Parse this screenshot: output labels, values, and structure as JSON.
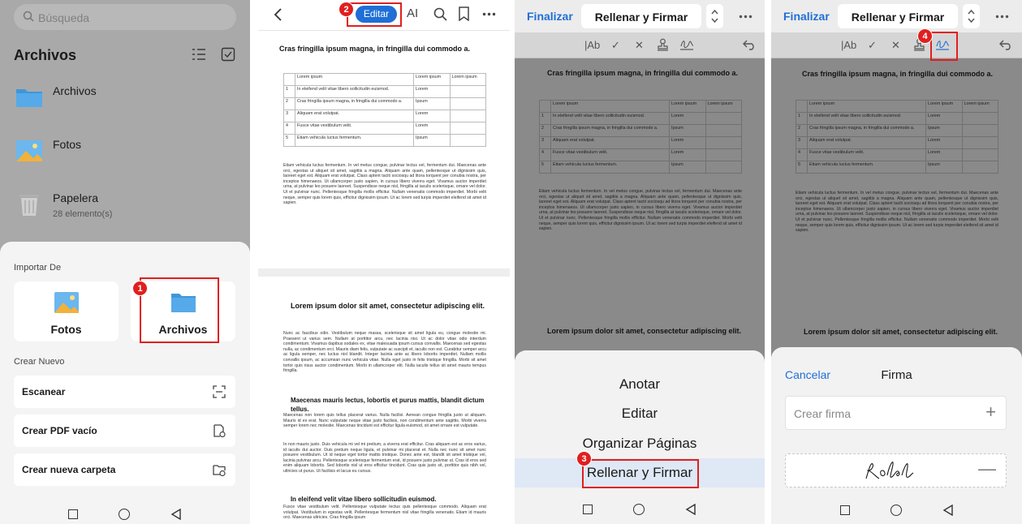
{
  "panel1": {
    "search_placeholder": "Búsqueda",
    "title": "Archivos",
    "files": [
      {
        "name": "Archivos",
        "meta": "",
        "icon": "folder-icon"
      },
      {
        "name": "Fotos",
        "meta": "",
        "icon": "photo-icon"
      },
      {
        "name": "Papelera",
        "meta": "28 elemento(s)",
        "icon": "trash-icon"
      }
    ],
    "import_label": "Importar De",
    "import_options": [
      {
        "label": "Fotos",
        "icon": "photo-icon"
      },
      {
        "label": "Archivos",
        "icon": "folder-icon"
      }
    ],
    "create_label": "Crear Nuevo",
    "create_options": [
      {
        "label": "Escanear",
        "icon": "scan-icon"
      },
      {
        "label": "Crear PDF vacío",
        "icon": "new-pdf-icon"
      },
      {
        "label": "Crear nueva carpeta",
        "icon": "new-folder-icon"
      }
    ],
    "badge": "1"
  },
  "panel2": {
    "edit_label": "Editar",
    "ai_label": "AI",
    "badge": "2",
    "doc": {
      "heading1": "Cras fringilla ipsum magna, in fringilla dui commodo a.",
      "table": {
        "header": [
          "",
          "Lorem ipsum",
          "Lorem ipsum",
          "Lorem ipsum"
        ],
        "rows": [
          [
            "1",
            "In eleifend velit vitae libero sollicitudin euismod.",
            "Lorem",
            ""
          ],
          [
            "2",
            "Cras fringilla ipsum magna, in fringilla dui commodo a.",
            "Ipsum",
            ""
          ],
          [
            "3",
            "Aliquam erat volutpat.",
            "Lorem",
            ""
          ],
          [
            "4",
            "Fusce vitae vestibulum velit.",
            "Lorem",
            ""
          ],
          [
            "5",
            "Etiam vehicula luctus fermentum.",
            "Ipsum",
            ""
          ]
        ]
      },
      "para1": "Etiam vehicula luctus fermentum. In vel metus congue, pulvinar lectus vel, fermentum dui. Maecenas ante orci, egestas ut aliquet sit amet, sagittis a magna. Aliquam ante quam, pellentesque ut dignissim quis, laoreet eget est. Aliquam erat volutpat. Class aptent taciti sociosqu ad litora torquent per conubia nostra, per inceptos himenaeos. Ut ullamcorper justo sapien, in cursus libero viverra eget. Vivamus auctor imperdiet urna, at pulvinar leo posuere laoreet. Suspendisse neque nisl, fringilla at iaculis scelerisque, ornare vel dolor. Ut et pulvinar nunc. Pellentesque fringilla mollis efficitur. Nullam venenatis commodo imperdiet. Morbi velit neque, semper quis lorem quis, efficitur dignissim ipsum. Ut ac lorem sed turpis imperdiet eleifend sit amet id sapien.",
      "heading2": "Lorem ipsum dolor sit amet, consectetur adipiscing elit.",
      "para2": "Nunc ac faucibus odio. Vestibulum neque massa, scelerisque sit amet ligula eu, congue molestie mi. Praesent ut varius sem. Nullam at porttitor arcu, nec lacinia nisi. Ut ac dolor vitae odio interdum condimentum. Vivamus dapibus sodales ex, vitae malesuada ipsum cursus convallis. Maecenas sed egestas nulla, ac condimentum orci. Mauris diam felis, vulputate ac suscipit et, iaculis non est. Curabitur semper arcu ac ligula semper, nec luctus nisl blandit. Integer lacinia ante ac libero lobortis imperdiet. Nullam mollis convallis ipsum, ac accumsan nunc vehicula vitae. Nulla eget justo in felis tristique fringilla. Morbi sit amet tortor quis risus auctor condimentum. Morbi in ullamcorper elit. Nulla iaculis tellus sit amet mauris tempus fringilla.",
      "heading3": "Maecenas mauris lectus, lobortis et purus mattis, blandit dictum tellus.",
      "para3": "Maecenas non lorem quis tellus placerat varius. Nulla facilisi. Aenean congue fringilla justo ut aliquam. Mauris id ex erat. Nunc vulputate neque vitae justo facilisis, non condimentum ante sagittis. Morbi viverra semper lorem nec molestie. Maecenas tincidunt est efficitur ligula euismod, sit amet ornare est vulputate.",
      "para4": "In non mauris justo. Duis vehicula mi vel mi pretium, a viverra erat efficitur. Cras aliquam est ac eros varius, id iaculis dui auctor. Duis pretium neque ligula, et pulvinar mi placerat et. Nulla nec nunc sit amet nunc posuere vestibulum. Ut id neque eget tortor mattis tristique. Donec ante est, blandit sit amet tristique vel, lacinia pulvinar arcu. Pellentesque scelerisque fermentum erat, id posuere justo pulvinar ut. Cras id eros sed enim aliquam lobortis. Sed lobortis nisl ut eros efficitur tincidunt. Cras quis justo sit, porttitor quis nibh vel, ultricies ut purus. Ut facilisis et lacus eu cursus.",
      "heading4": "In eleifend velit vitae libero sollicitudin euismod.",
      "para5": "Fusce vitae vestibulum velit. Pellentesque vulputate lectus quis pellentesque commodo. Aliquam erat volutpat. Vestibulum in egestas velit. Pellentesque fermentum nisl vitae fringilla venenatis. Etiam id mauris orci. Maecenas ultricies. Cras fringilla ipsum"
    }
  },
  "panel3": {
    "finalize": "Finalizar",
    "mode": "Rellenar y Firmar",
    "menu": [
      "Anotar",
      "Editar",
      "Organizar Páginas",
      "Rellenar y Firmar"
    ],
    "selected_index": 3,
    "badge": "3"
  },
  "panel4": {
    "finalize": "Finalizar",
    "mode": "Rellenar y Firmar",
    "cancel": "Cancelar",
    "sheet_title": "Firma",
    "create_signature": "Crear firma",
    "badge": "4"
  },
  "colors": {
    "accent": "#1f6fd6",
    "marker": "#e01f1f"
  }
}
